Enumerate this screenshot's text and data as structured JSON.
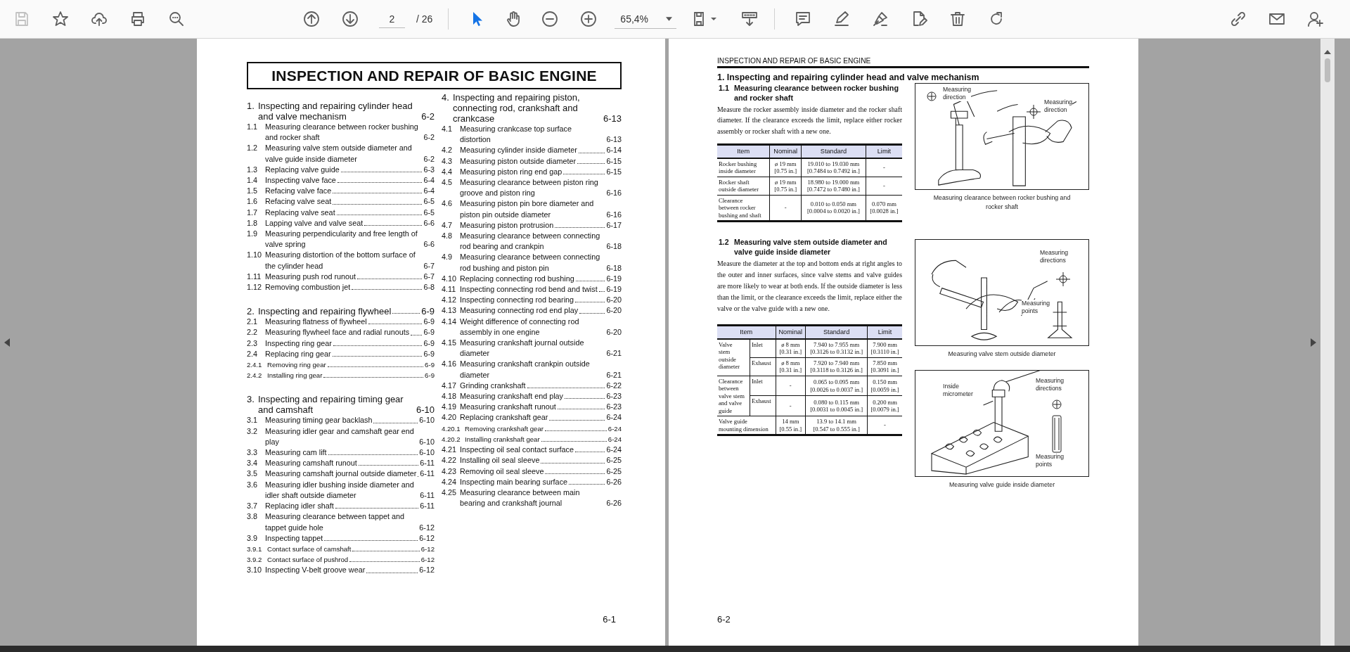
{
  "toolbar": {
    "save": {
      "disabled": true
    },
    "page_current": "2",
    "page_total": "/ 26",
    "tools": [
      {
        "selected": true
      },
      {
        "selected": false
      }
    ],
    "zoom": "65,4%"
  },
  "left_page": {
    "title": "INSPECTION AND REPAIR OF BASIC ENGINE",
    "page_number": "6-1",
    "columns": [
      {
        "sections": [
          {
            "number": "1.",
            "title": "Inspecting and repairing cylinder head and valve mechanism",
            "page": "6-2",
            "items": [
              {
                "number": "1.1",
                "title": "Measuring clearance between rocker bushing and rocker shaft",
                "page": "6-2"
              },
              {
                "number": "1.2",
                "title": "Measuring valve stem outside diameter and valve guide inside diameter",
                "page": "6-2"
              },
              {
                "number": "1.3",
                "title": "Replacing valve guide",
                "page": "6-3"
              },
              {
                "number": "1.4",
                "title": "Inspecting valve face",
                "page": "6-4"
              },
              {
                "number": "1.5",
                "title": "Refacing valve face",
                "page": "6-4"
              },
              {
                "number": "1.6",
                "title": "Refacing valve seat",
                "page": "6-5"
              },
              {
                "number": "1.7",
                "title": "Replacing valve seat",
                "page": "6-5"
              },
              {
                "number": "1.8",
                "title": "Lapping valve and valve seat",
                "page": "6-6"
              },
              {
                "number": "1.9",
                "title": "Measuring perpendicularity and free length of valve spring",
                "page": "6-6"
              },
              {
                "number": "1.10",
                "title": "Measuring distortion of the bottom surface of the cylinder head",
                "page": "6-7"
              },
              {
                "number": "1.11",
                "title": "Measuring push rod runout",
                "page": "6-7"
              },
              {
                "number": "1.12",
                "title": "Removing combustion jet",
                "page": "6-8"
              }
            ]
          },
          {
            "number": "2.",
            "title": "Inspecting and repairing flywheel",
            "page": "6-9",
            "items": [
              {
                "number": "2.1",
                "title": "Measuring flatness of flywheel",
                "page": "6-9"
              },
              {
                "number": "2.2",
                "title": "Measuring flywheel face and radial runouts",
                "page": "6-9"
              },
              {
                "number": "2.3",
                "title": "Inspecting ring gear",
                "page": "6-9"
              },
              {
                "number": "2.4",
                "title": "Replacing ring gear",
                "page": "6-9",
                "children": [
                  {
                    "number": "2.4.1",
                    "title": "Removing ring gear",
                    "page": "6-9"
                  },
                  {
                    "number": "2.4.2",
                    "title": "Installing ring gear",
                    "page": "6-9"
                  }
                ]
              }
            ]
          },
          {
            "number": "3.",
            "title": "Inspecting and repairing timing gear and camshaft",
            "page": "6-10",
            "items": [
              {
                "number": "3.1",
                "title": "Measuring timing gear backlash",
                "page": "6-10"
              },
              {
                "number": "3.2",
                "title": "Measuring idler gear and camshaft gear end play",
                "page": "6-10"
              },
              {
                "number": "3.3",
                "title": "Measuring cam lift",
                "page": "6-10"
              },
              {
                "number": "3.4",
                "title": "Measuring camshaft runout",
                "page": "6-11"
              },
              {
                "number": "3.5",
                "title": "Measuring camshaft journal outside diameter",
                "page": "6-11"
              },
              {
                "number": "3.6",
                "title": "Measuring idler bushing inside diameter and idler shaft outside diameter",
                "page": "6-11"
              },
              {
                "number": "3.7",
                "title": "Replacing idler shaft",
                "page": "6-11"
              },
              {
                "number": "3.8",
                "title": "Measuring clearance between tappet and tappet guide hole",
                "page": "6-12"
              },
              {
                "number": "3.9",
                "title": "Inspecting tappet",
                "page": "6-12",
                "children": [
                  {
                    "number": "3.9.1",
                    "title": "Contact surface of camshaft",
                    "page": "6-12"
                  },
                  {
                    "number": "3.9.2",
                    "title": "Contact surface of pushrod",
                    "page": "6-12"
                  }
                ]
              },
              {
                "number": "3.10",
                "title": "Inspecting V-belt groove wear",
                "page": "6-12"
              }
            ]
          }
        ]
      },
      {
        "sections": [
          {
            "number": "4.",
            "title": "Inspecting and repairing piston, connecting rod, crankshaft and crankcase",
            "page": "6-13",
            "items": [
              {
                "number": "4.1",
                "title": "Measuring crankcase top surface distortion",
                "page": "6-13"
              },
              {
                "number": "4.2",
                "title": "Measuring cylinder inside diameter",
                "page": "6-14"
              },
              {
                "number": "4.3",
                "title": "Measuring piston outside diameter",
                "page": "6-15"
              },
              {
                "number": "4.4",
                "title": "Measuring piston ring end gap",
                "page": "6-15"
              },
              {
                "number": "4.5",
                "title": "Measuring clearance between piston ring groove and piston ring",
                "page": "6-16"
              },
              {
                "number": "4.6",
                "title": "Measuring piston pin bore diameter and piston pin outside diameter",
                "page": "6-16"
              },
              {
                "number": "4.7",
                "title": "Measuring piston protrusion",
                "page": "6-17"
              },
              {
                "number": "4.8",
                "title": "Measuring clearance between connecting rod bearing and crankpin",
                "page": "6-18"
              },
              {
                "number": "4.9",
                "title": "Measuring clearance between connecting rod bushing and piston pin",
                "page": "6-18"
              },
              {
                "number": "4.10",
                "title": "Replacing connecting rod bushing",
                "page": "6-19"
              },
              {
                "number": "4.11",
                "title": "Inspecting connecting rod bend and twist",
                "page": "6-19"
              },
              {
                "number": "4.12",
                "title": "Inspecting connecting rod bearing",
                "page": "6-20"
              },
              {
                "number": "4.13",
                "title": "Measuring connecting rod end play",
                "page": "6-20"
              },
              {
                "number": "4.14",
                "title": "Weight difference of connecting rod assembly in one engine",
                "page": "6-20"
              },
              {
                "number": "4.15",
                "title": "Measuring crankshaft journal outside diameter",
                "page": "6-21"
              },
              {
                "number": "4.16",
                "title": "Measuring crankshaft crankpin outside diameter",
                "page": "6-21"
              },
              {
                "number": "4.17",
                "title": "Grinding crankshaft",
                "page": "6-22"
              },
              {
                "number": "4.18",
                "title": "Measuring crankshaft end play",
                "page": "6-23"
              },
              {
                "number": "4.19",
                "title": "Measuring crankshaft runout",
                "page": "6-23"
              },
              {
                "number": "4.20",
                "title": "Replacing crankshaft gear",
                "page": "6-24",
                "children": [
                  {
                    "number": "4.20.1",
                    "title": "Removing crankshaft gear",
                    "page": "6-24"
                  },
                  {
                    "number": "4.20.2",
                    "title": "Installing crankshaft gear",
                    "page": "6-24"
                  }
                ]
              },
              {
                "number": "4.21",
                "title": "Inspecting oil seal contact surface",
                "page": "6-24"
              },
              {
                "number": "4.22",
                "title": "Installing oil seal sleeve",
                "page": "6-25"
              },
              {
                "number": "4.23",
                "title": "Removing oil seal sleeve",
                "page": "6-25"
              },
              {
                "number": "4.24",
                "title": "Inspecting main bearing surface",
                "page": "6-26"
              },
              {
                "number": "4.25",
                "title": "Measuring clearance between main bearing and crankshaft journal",
                "page": "6-26"
              }
            ]
          }
        ]
      }
    ]
  },
  "right_page": {
    "running_header": "INSPECTION AND REPAIR OF BASIC ENGINE",
    "heading": "1. Inspecting and repairing cylinder head and valve mechanism",
    "page_number": "6-2",
    "subsections": [
      {
        "number": "1.1",
        "title": "Measuring clearance between rocker bushing and rocker shaft",
        "paragraph": "Measure the rocker assembly inside diameter and the rocker shaft diameter. If the clearance exceeds the limit, replace either rocker assembly or rocker shaft with a new one.",
        "table": {
          "columns": [
            "Item",
            "Nominal",
            "Standard",
            "Limit"
          ],
          "rows": [
            {
              "item": "Rocker bushing\ninside diameter",
              "nominal": "ø 19 mm\n[0.75 in.]",
              "standard": "19.010 to 19.030 mm\n[0.7484 to 0.7492 in.]",
              "limit": "-"
            },
            {
              "item": "Rocker shaft\noutside diameter",
              "nominal": "ø 19 mm\n[0.75 in.]",
              "standard": "18.980 to 19.000 mm\n[0.7472 to 0.7480 in.]",
              "limit": "-"
            },
            {
              "item": "Clearance\nbetween rocker\nbushing and shaft",
              "nominal": "-",
              "standard": "0.010 to 0.050 mm\n[0.0004 to 0.0020 in.]",
              "limit": "0.070 mm\n[0.0028 in.]"
            }
          ]
        }
      },
      {
        "number": "1.2",
        "title": "Measuring valve stem outside diameter and valve guide inside diameter",
        "paragraph": "Measure the diameter at the top and bottom ends at right angles to the outer and inner surfaces, since valve stems and valve guides are more likely to wear at both ends. If the outside diameter is less than the limit, or the clearance exceeds the limit, replace either the valve or the valve guide with a new one.",
        "table": {
          "columns": [
            "Item",
            "Nominal",
            "Standard",
            "Limit"
          ],
          "rows": [
            {
              "item": "Valve\nstem\noutside\ndiameter",
              "sub_rows": [
                {
                  "type": "Inlet",
                  "nominal": "ø 8 mm\n[0.31 in.]",
                  "standard": "7.940 to 7.955 mm\n[0.3126 to 0.3132 in.]",
                  "limit": "7.900 mm\n[0.3110 in.]"
                },
                {
                  "type": "Exhaust",
                  "nominal": "ø 8 mm\n[0.31 in.]",
                  "standard": "7.920 to 7.940 mm\n[0.3118 to 0.3126 in.]",
                  "limit": "7.850 mm\n[0.3091 in.]"
                }
              ]
            },
            {
              "item": "Clearance\nbetween\nvalve stem\nand valve\nguide",
              "sub_rows": [
                {
                  "type": "Inlet",
                  "nominal": "-",
                  "standard": "0.065 to 0.095 mm\n[0.0026 to 0.0037 in.]",
                  "limit": "0.150 mm\n[0.0059 in.]"
                },
                {
                  "type": "Exhaust",
                  "nominal": "-",
                  "standard": "0.080 to 0.115 mm\n[0.0031 to 0.0045 in.]",
                  "limit": "0.200 mm\n[0.0079 in.]"
                }
              ]
            },
            {
              "item": "Valve guide\nmounting dimension",
              "nominal": "14 mm\n[0.55 in.]",
              "standard": "13.9 to 14.1 mm\n[0.547 to 0.555 in.]",
              "limit": "-"
            }
          ]
        }
      }
    ],
    "figures": [
      {
        "labels": [
          "Measuring\ndirection",
          "Measuring\ndirection"
        ],
        "caption": "Measuring clearance between rocker bushing and\nrocker shaft"
      },
      {
        "labels": [
          "Measuring\ndirections",
          "Measuring\npoints"
        ],
        "caption": "Measuring valve stem outside diameter"
      },
      {
        "labels": [
          "Inside\nmicrometer",
          "Measuring\ndirections",
          "Measuring\npoints"
        ],
        "caption": "Measuring valve guide inside diameter"
      }
    ]
  }
}
